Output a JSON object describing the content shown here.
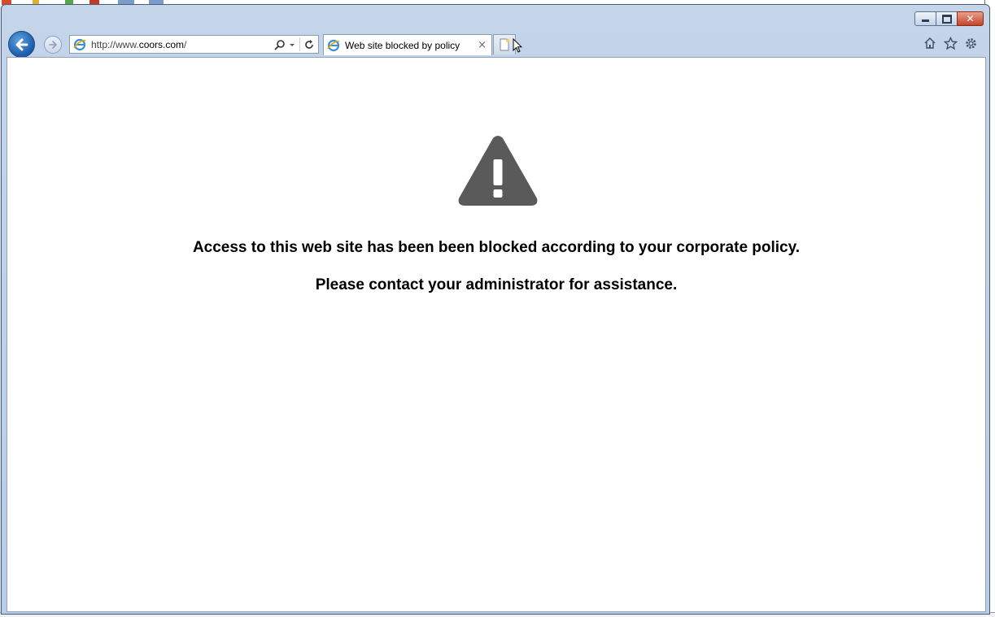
{
  "window": {
    "caption_buttons": {
      "minimize_icon": "minimize-icon",
      "maximize_icon": "restore-icon",
      "close_icon": "close-icon",
      "close_color": "#c4452b"
    }
  },
  "toolbar": {
    "back_icon": "back-arrow-icon",
    "forward_icon": "forward-arrow-icon",
    "address": {
      "url_prefix": "http://www.",
      "url_domain": "coors.com",
      "url_suffix": "/"
    },
    "tab": {
      "title": "Web site blocked by policy",
      "close_glyph": "×"
    },
    "right_icons": [
      "home-icon",
      "favorites-star-icon",
      "tools-gear-icon"
    ]
  },
  "content": {
    "icon": "warning-triangle-icon",
    "message_primary": "Access to this web site has been been blocked according to your corporate policy.",
    "message_secondary": "Please contact your administrator for assistance."
  },
  "colors": {
    "warning_icon": "#5a5a5a",
    "back_button": "#1a5aa8",
    "chrome": "#c4d5ea"
  }
}
